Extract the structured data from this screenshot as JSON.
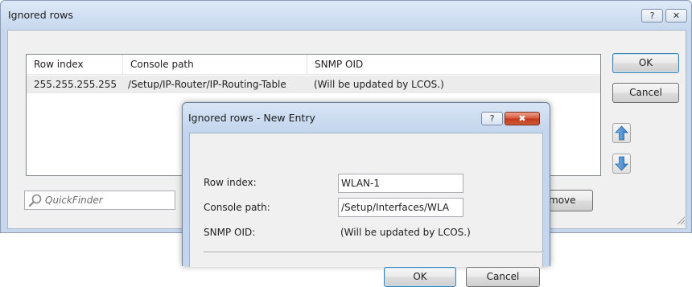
{
  "outer_window": {
    "title": "Ignored rows",
    "help_glyph": "?",
    "close_glyph": "✕",
    "ok_label": "OK",
    "cancel_label": "Cancel",
    "remove_label_visible": "move",
    "quickfinder_placeholder": "QuickFinder",
    "icons": {
      "up": "arrow-up-icon",
      "down": "arrow-down-icon",
      "search": "search-icon",
      "grip": "resize-grip-icon"
    },
    "table": {
      "columns": [
        "Row index",
        "Console path",
        "SNMP OID"
      ],
      "rows": [
        {
          "row_index": "255.255.255.255",
          "console_path": "/Setup/IP-Router/IP-Routing-Table",
          "snmp_oid": "(Will be updated by LCOS.)"
        }
      ]
    }
  },
  "dialog": {
    "title": "Ignored rows - New Entry",
    "help_glyph": "?",
    "close_glyph": "✖",
    "fields": {
      "row_index_label": "Row index:",
      "row_index_value": "WLAN-1",
      "console_path_label": "Console path:",
      "console_path_value": "/Setup/Interfaces/WLA",
      "snmp_oid_label": "SNMP OID:",
      "snmp_oid_value": "(Will be updated by LCOS.)"
    },
    "ok_label": "OK",
    "cancel_label": "Cancel"
  },
  "colors": {
    "title_bar": "#c7d8ee",
    "close_button": "#c2391d",
    "arrow_blue": "#3f8ed6",
    "selected_row": "#ececec"
  }
}
